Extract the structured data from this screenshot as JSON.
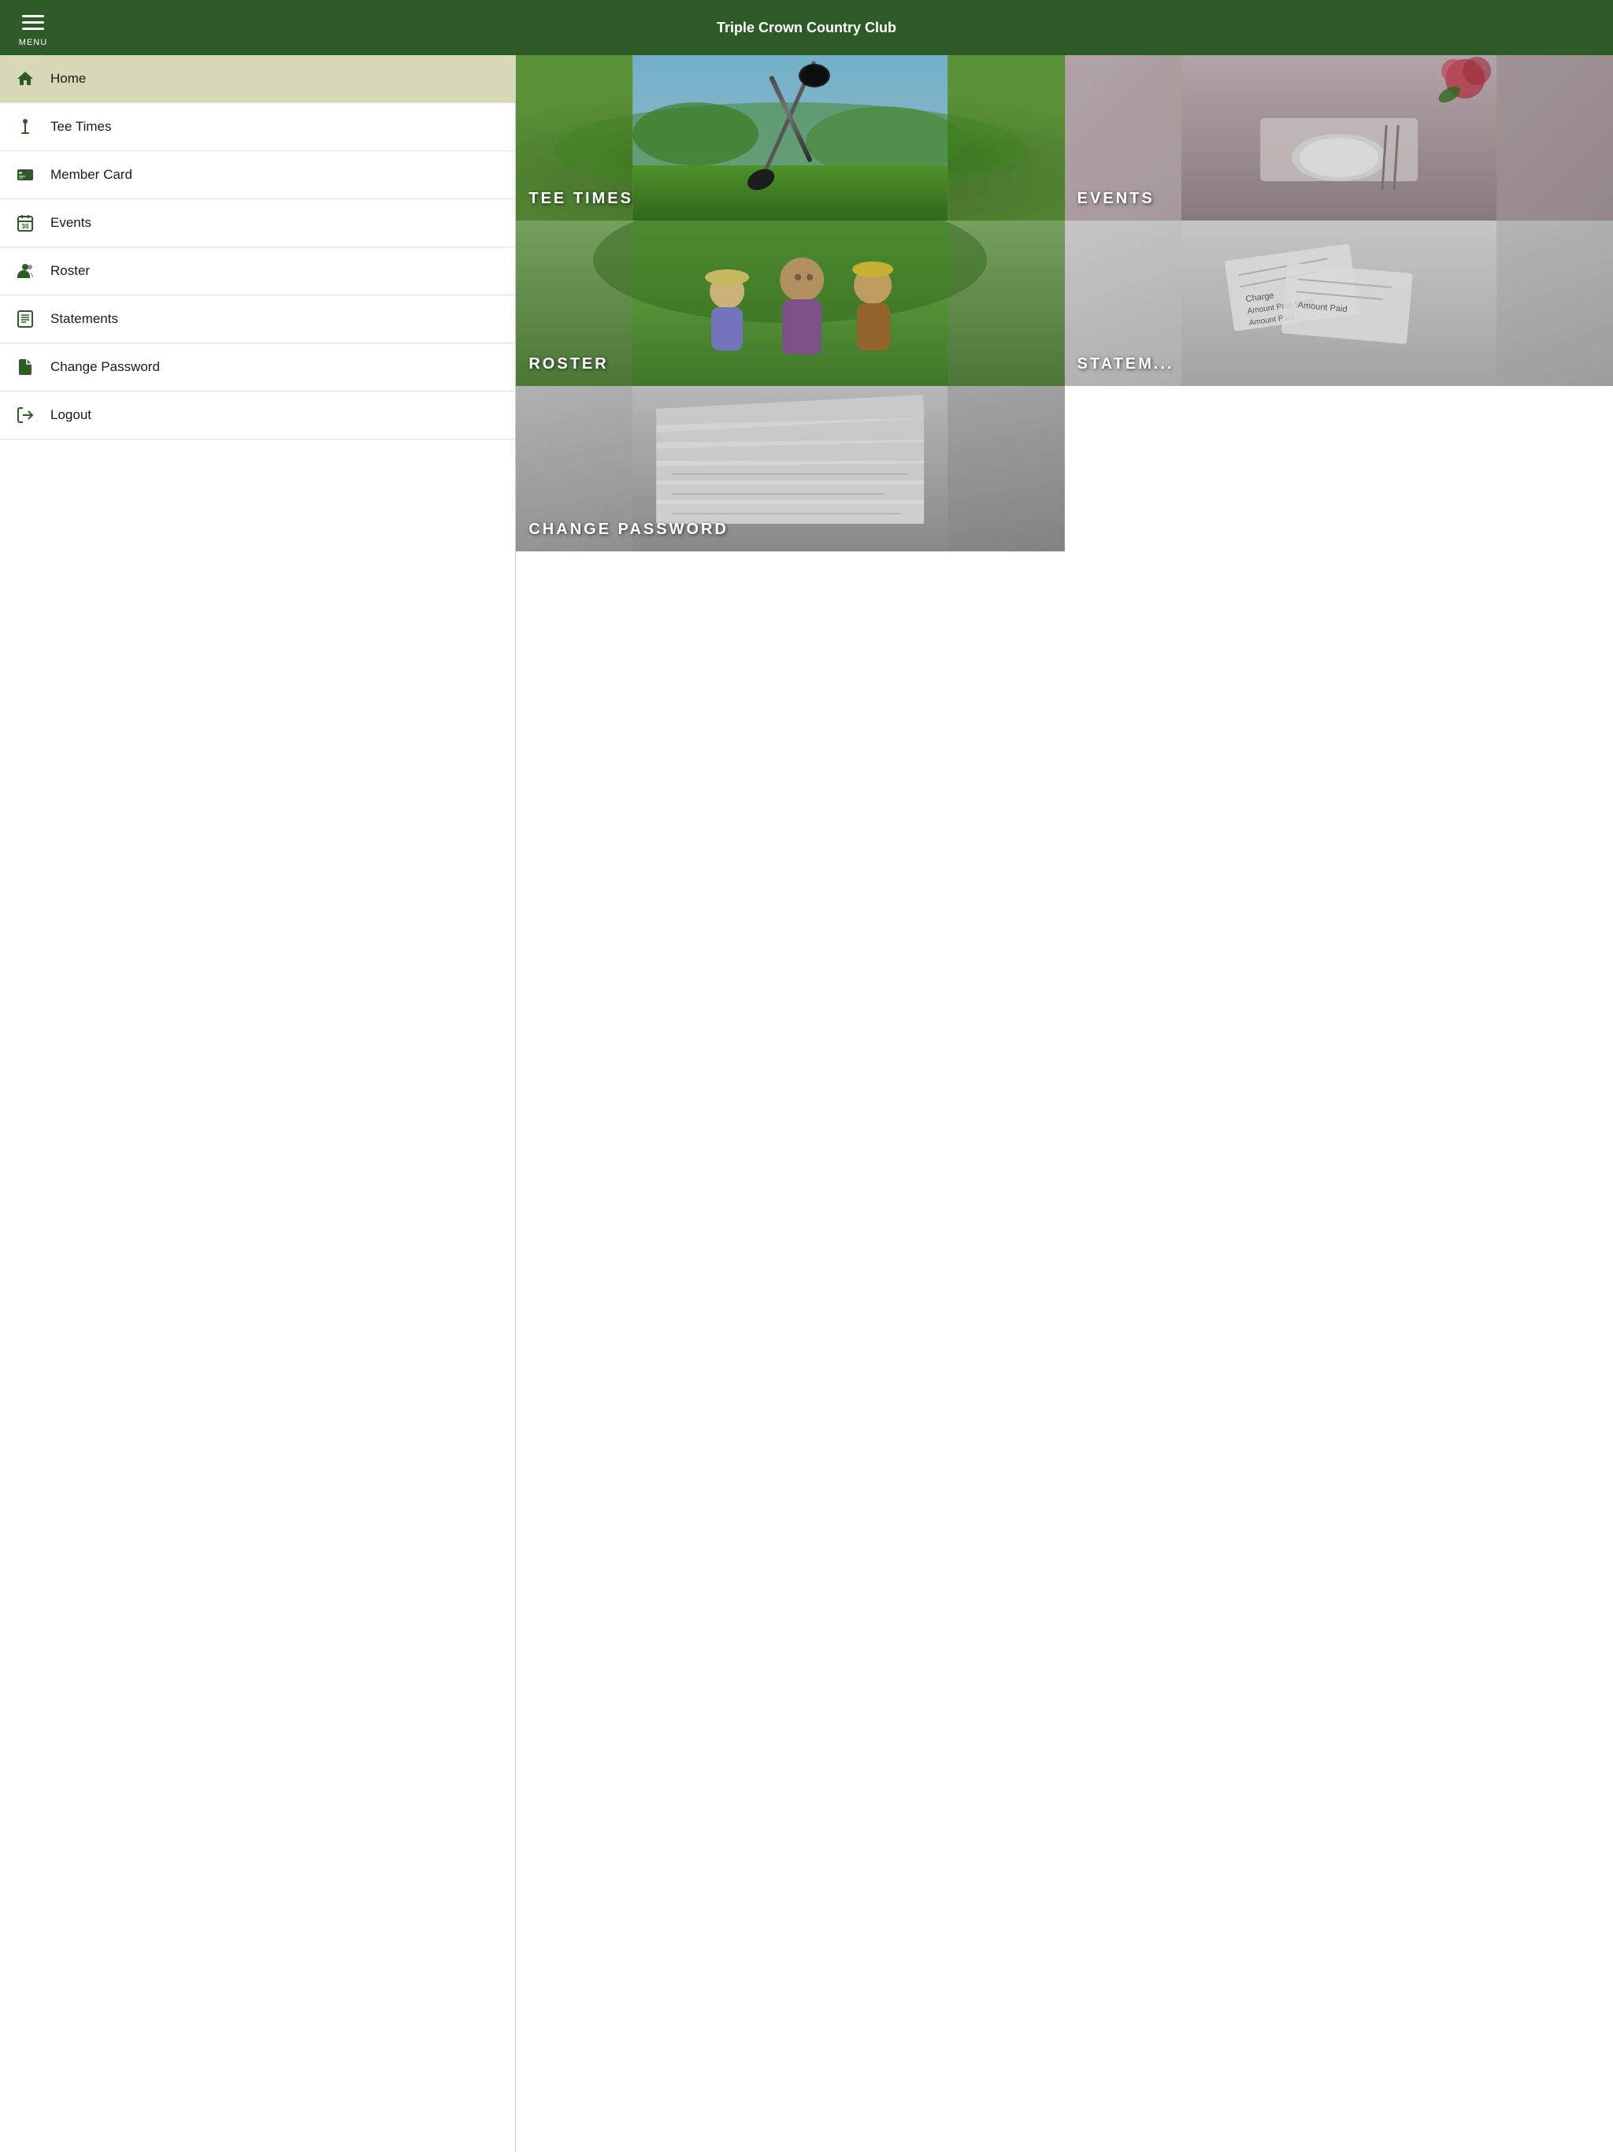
{
  "header": {
    "menu_label": "MENU",
    "title": "Triple Crown Country Club"
  },
  "sidebar": {
    "items": [
      {
        "id": "home",
        "label": "Home",
        "icon": "house",
        "active": true
      },
      {
        "id": "tee-times",
        "label": "Tee Times",
        "icon": "flag",
        "active": false
      },
      {
        "id": "member-card",
        "label": "Member Card",
        "icon": "card",
        "active": false
      },
      {
        "id": "events",
        "label": "Events",
        "icon": "calendar",
        "active": false
      },
      {
        "id": "roster",
        "label": "Roster",
        "icon": "person",
        "active": false
      },
      {
        "id": "statements",
        "label": "Statements",
        "icon": "list",
        "active": false
      },
      {
        "id": "change-password",
        "label": "Change Password",
        "icon": "document",
        "active": false
      },
      {
        "id": "logout",
        "label": "Logout",
        "icon": "logout",
        "active": false
      }
    ]
  },
  "tiles": [
    {
      "id": "tee-times",
      "label": "TEE TIMES",
      "col": "half"
    },
    {
      "id": "events",
      "label": "EVENTS",
      "col": "half"
    },
    {
      "id": "roster",
      "label": "ROSTER",
      "col": "half"
    },
    {
      "id": "statements",
      "label": "STATEM...",
      "col": "half"
    },
    {
      "id": "change-password",
      "label": "CHANGE PASSWORD",
      "col": "full"
    }
  ]
}
